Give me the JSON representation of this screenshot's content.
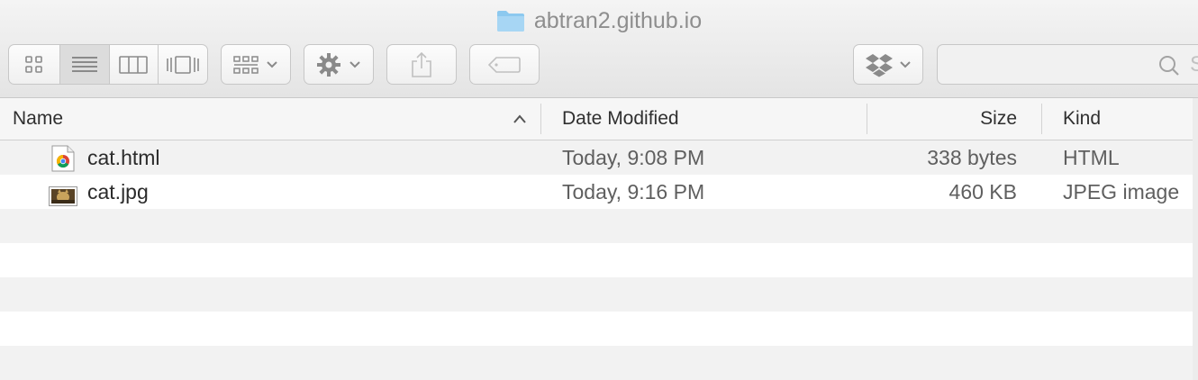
{
  "window": {
    "title": "abtran2.github.io"
  },
  "toolbar": {
    "view_buttons": [
      "icon-view",
      "list-view",
      "column-view",
      "cover-flow-view"
    ],
    "arrange_icon": "arrange-icon",
    "action_icon": "gear-icon",
    "share_icon": "share-icon",
    "tag_icon": "tag-icon",
    "dropbox_icon": "dropbox-icon"
  },
  "search": {
    "placeholder_visible": "S"
  },
  "columns": {
    "name": "Name",
    "date": "Date Modified",
    "size": "Size",
    "kind": "Kind"
  },
  "files": [
    {
      "name": "cat.html",
      "date": "Today, 9:08 PM",
      "size": "338 bytes",
      "kind": "HTML",
      "icon": "chrome-html-icon"
    },
    {
      "name": "cat.jpg",
      "date": "Today, 9:16 PM",
      "size": "460 KB",
      "kind": "JPEG image",
      "icon": "jpeg-thumbnail-icon"
    }
  ],
  "colors": {
    "folder": "#8cc9ef",
    "selection_none": "#ffffff"
  }
}
